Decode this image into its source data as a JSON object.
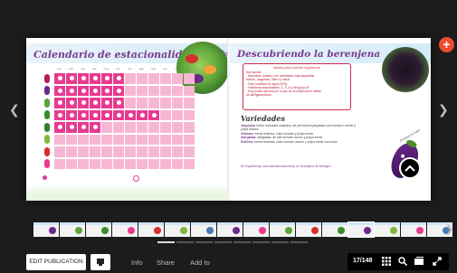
{
  "left_page": {
    "title": "Calendario de estacionalidad de Verduras",
    "months": [
      "ene",
      "feb",
      "mar",
      "abr",
      "may",
      "jun",
      "jul",
      "ago",
      "sep",
      "oct",
      "nov",
      "dic"
    ],
    "rows": [
      {
        "color": "#b2225b",
        "cells": [
          "dot",
          "dot",
          "dot",
          "dot",
          "dot",
          "dot",
          "pink",
          "pink",
          "pink",
          "pink",
          "pink",
          "pink"
        ]
      },
      {
        "color": "#6a2a8a",
        "cells": [
          "dot",
          "dot",
          "dot",
          "dot",
          "dot",
          "dot",
          "pink",
          "pink",
          "pink",
          "pink",
          "pink",
          "pink"
        ]
      },
      {
        "color": "#5da53a",
        "cells": [
          "dot",
          "ring",
          "dot",
          "dot",
          "dot",
          "dot",
          "pink",
          "pink",
          "pink",
          "pink",
          "pink",
          "pink"
        ]
      },
      {
        "color": "#3a8d2e",
        "cells": [
          "dot",
          "ring",
          "ring",
          "dot",
          "dot",
          "dot",
          "dot",
          "dot",
          "dot",
          "pink",
          "pink",
          "pink"
        ]
      },
      {
        "color": "#2f7f2b",
        "cells": [
          "ring",
          "ring",
          "ring",
          "ring",
          "pink",
          "pink",
          "pink",
          "pink",
          "pink",
          "pink",
          "pink",
          "pink"
        ]
      },
      {
        "color": "#7fb83a",
        "cells": [
          "pink",
          "pink",
          "pink",
          "pink",
          "pink",
          "pink",
          "pink",
          "pink",
          "pink",
          "pink",
          "pink",
          "pink"
        ]
      },
      {
        "color": "#d63030",
        "cells": [
          "pink",
          "pink",
          "pink",
          "pink",
          "pink",
          "pink",
          "pink",
          "pink",
          "pink",
          "pink",
          "pink",
          "pink"
        ]
      },
      {
        "color": "#e73b8f",
        "cells": [
          "pink",
          "pink",
          "pink",
          "pink",
          "pink",
          "pink",
          "pink",
          "pink",
          "pink",
          "pink",
          "pink",
          "pink"
        ]
      }
    ],
    "footnote": "",
    "legend_full": "",
    "legend_partial": ""
  },
  "right_page": {
    "title": "Descubriendo la berenjena",
    "box_title": "Aliada para nuestro organismo",
    "box_lines": [
      "Nos aporta:",
      "· Minerales: potasio y en cantidades más pequeñas",
      "  fósforo, magnesio, hierro y calcio.",
      "· Gran cantidad de agua (92%).",
      "· Vitaminas antioxidantes: C, E, A y del grupo B.",
      "· Muy pocas calorías por lo que se recomienda en dietas",
      "  de adelgazamiento."
    ],
    "varieties_title": "Variedades",
    "varieties": [
      {
        "name": "Jaspeada:",
        "text": "frutos redondos ovalados, de piel blanca jaspeada con morado o verde y pulpa blanca."
      },
      {
        "name": "Globosa:",
        "text": "forma esférica, color morado y pulpa verde."
      },
      {
        "name": "Alargadas:",
        "text": "alargadas, de piel morado oscuro y pulpa verde."
      },
      {
        "name": "Esférica:",
        "text": "forma redonda, color morado oscuro y pulpa verde con sucio."
      }
    ],
    "footer_note": "En España hay una variedad autóctona, la \"berenjena de Almagro\".",
    "speech": "¡Prueba mi hoja!"
  },
  "viewer": {
    "edit_label": "EDIT PUBLICATION",
    "links": [
      "Info",
      "Share",
      "Add to"
    ],
    "page_indicator": "17/148",
    "plus_icon": "+",
    "colors": {
      "accent": "#ec4d2e",
      "bg": "#1c1c1c",
      "purple": "#7a3c8e",
      "pink": "#e73b8f"
    }
  },
  "thumbnails": [
    {
      "accent": "#6a2a8a"
    },
    {
      "accent": "#5da53a"
    },
    {
      "accent": "#3a8d2e"
    },
    {
      "accent": "#e73b8f"
    },
    {
      "accent": "#d63030"
    },
    {
      "accent": "#7fb83a"
    },
    {
      "accent": "#4a7bb3"
    },
    {
      "accent": "#6a2a8a"
    },
    {
      "accent": "#e73b8f"
    },
    {
      "accent": "#5da53a"
    },
    {
      "accent": "#d63030"
    },
    {
      "accent": "#3a8d2e"
    },
    {
      "accent": "#6a2a8a"
    },
    {
      "accent": "#7fb83a"
    },
    {
      "accent": "#e73b8f"
    },
    {
      "accent": "#4a7bb3"
    }
  ],
  "active_thumbnail": 12
}
